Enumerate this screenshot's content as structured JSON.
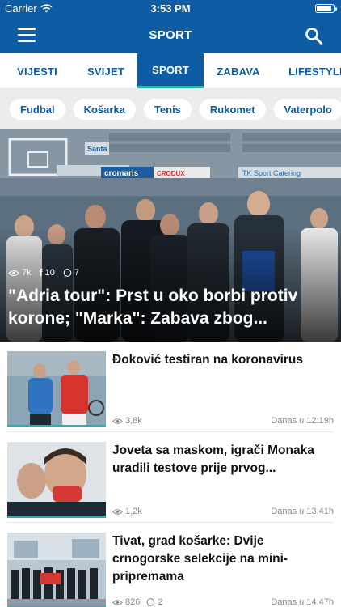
{
  "status": {
    "carrier": "Carrier",
    "time": "3:53 PM"
  },
  "nav": {
    "title": "SPORT"
  },
  "tabs": [
    {
      "label": "VIJESTI",
      "active": false
    },
    {
      "label": "SVIJET",
      "active": false
    },
    {
      "label": "SPORT",
      "active": true
    },
    {
      "label": "ZABAVA",
      "active": false
    },
    {
      "label": "LIFESTYLE",
      "active": false
    }
  ],
  "chips": [
    "Fudbal",
    "Košarka",
    "Tenis",
    "Rukomet",
    "Vaterpolo"
  ],
  "hero": {
    "views": "7k",
    "likes": "10",
    "comments": "7",
    "headline": "\"Adria tour\": Prst u oko borbi protiv korone; \"Marka\": Zabava zbog...",
    "signage": [
      "Santa",
      "cromaris",
      "CRODUX",
      "TK Sport Catering"
    ]
  },
  "articles": [
    {
      "title": "Đoković testiran na koronavirus",
      "views": "3,8k",
      "comments": "",
      "date": "Danas u 12:19h"
    },
    {
      "title": "Joveta sa maskom, igrači Monaka uradili testove prije prvog...",
      "views": "1,2k",
      "comments": "",
      "date": "Danas u 13:41h"
    },
    {
      "title": "Tivat, grad košarke: Dvije crnogorske selekcije na mini-pripremama",
      "views": "826",
      "comments": "2",
      "date": "Danas u 14:47h"
    }
  ],
  "colors": {
    "brand": "#0d5ca4",
    "accent": "#2ab0a4",
    "chip_bg": "#ececec"
  }
}
